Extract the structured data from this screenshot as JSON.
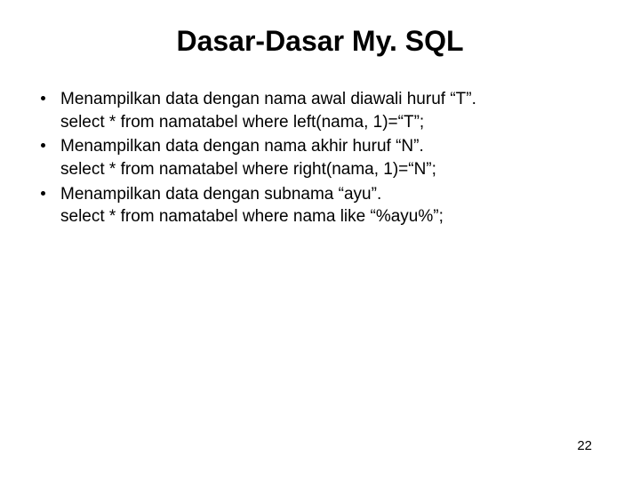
{
  "title": "Dasar-Dasar My. SQL",
  "bullets": [
    {
      "desc": "Menampilkan data dengan nama awal diawali huruf “T”.",
      "sql": "select * from namatabel where left(nama, 1)=“T”;"
    },
    {
      "desc": "Menampilkan data dengan nama akhir huruf “N”.",
      "sql": "select * from namatabel where right(nama, 1)=“N”;"
    },
    {
      "desc": "Menampilkan data dengan subnama “ayu”.",
      "sql": "select * from namatabel where nama like “%ayu%”;"
    }
  ],
  "page_number": "22"
}
